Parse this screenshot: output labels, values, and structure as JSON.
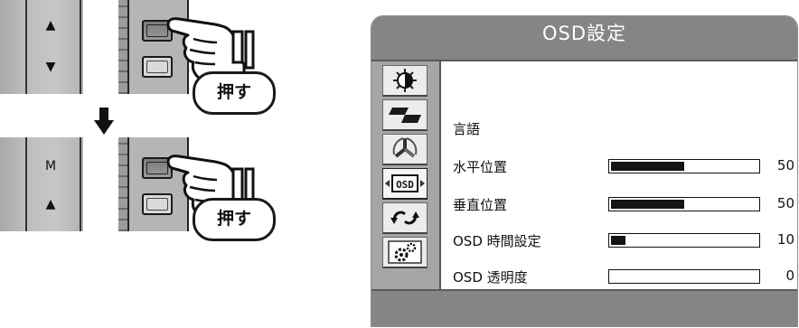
{
  "illustration": {
    "top_strip_symbols": [
      "▲",
      "▼"
    ],
    "bottom_strip_symbols": [
      "M",
      "▲"
    ],
    "press_label": "押す"
  },
  "osd": {
    "title": "OSD設定",
    "icons": [
      "brightness-contrast-icon",
      "image-geometry-icon",
      "color-icon",
      "osd-icon",
      "reset-icon",
      "settings-icon"
    ],
    "selected_icon": "osd-icon",
    "menu_label_language": "言語",
    "rows": [
      {
        "label": "水平位置",
        "value": "50",
        "level": 0.5
      },
      {
        "label": "垂直位置",
        "value": "50",
        "level": 0.5
      },
      {
        "label": "OSD 時間設定",
        "value": "10",
        "level": 0.1
      },
      {
        "label": "OSD 透明度",
        "value": "0",
        "level": 0.0
      }
    ]
  },
  "colors": {
    "osd_bar_gray": "#858585",
    "icon_column": "#a6a6a6",
    "bar_fill": "#141414"
  }
}
